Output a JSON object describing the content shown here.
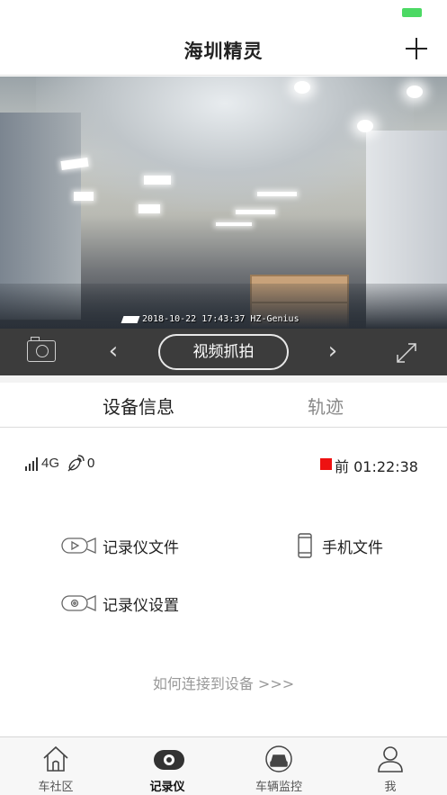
{
  "app": {
    "title": "海圳精灵"
  },
  "video": {
    "timestamp": "2018-10-22  17:43:37  HZ-Genius"
  },
  "controls": {
    "capture_label": "视频抓拍",
    "prev_symbol": "‹",
    "next_symbol": "›"
  },
  "tabs": [
    {
      "label": "设备信息",
      "active": true
    },
    {
      "label": "轨迹",
      "active": false
    }
  ],
  "device_status": {
    "network": "4G",
    "satellites": "0",
    "recording": "前 01:22:38",
    "recording_color": "#ee1111"
  },
  "functions": {
    "recorder_files": "记录仪文件",
    "phone_files": "手机文件",
    "recorder_settings": "记录仪设置"
  },
  "help_link": "如何连接到设备 >>>",
  "bottom_nav": [
    {
      "label": "车社区",
      "icon": "home-icon",
      "active": false
    },
    {
      "label": "记录仪",
      "icon": "dashcam-icon",
      "active": true
    },
    {
      "label": "车辆监控",
      "icon": "car-monitor-icon",
      "active": false
    },
    {
      "label": "我",
      "icon": "user-icon",
      "active": false
    }
  ],
  "colors": {
    "accent_battery": "#4cd964",
    "control_bar": "#3c3c3c",
    "recording": "#ee1111"
  }
}
